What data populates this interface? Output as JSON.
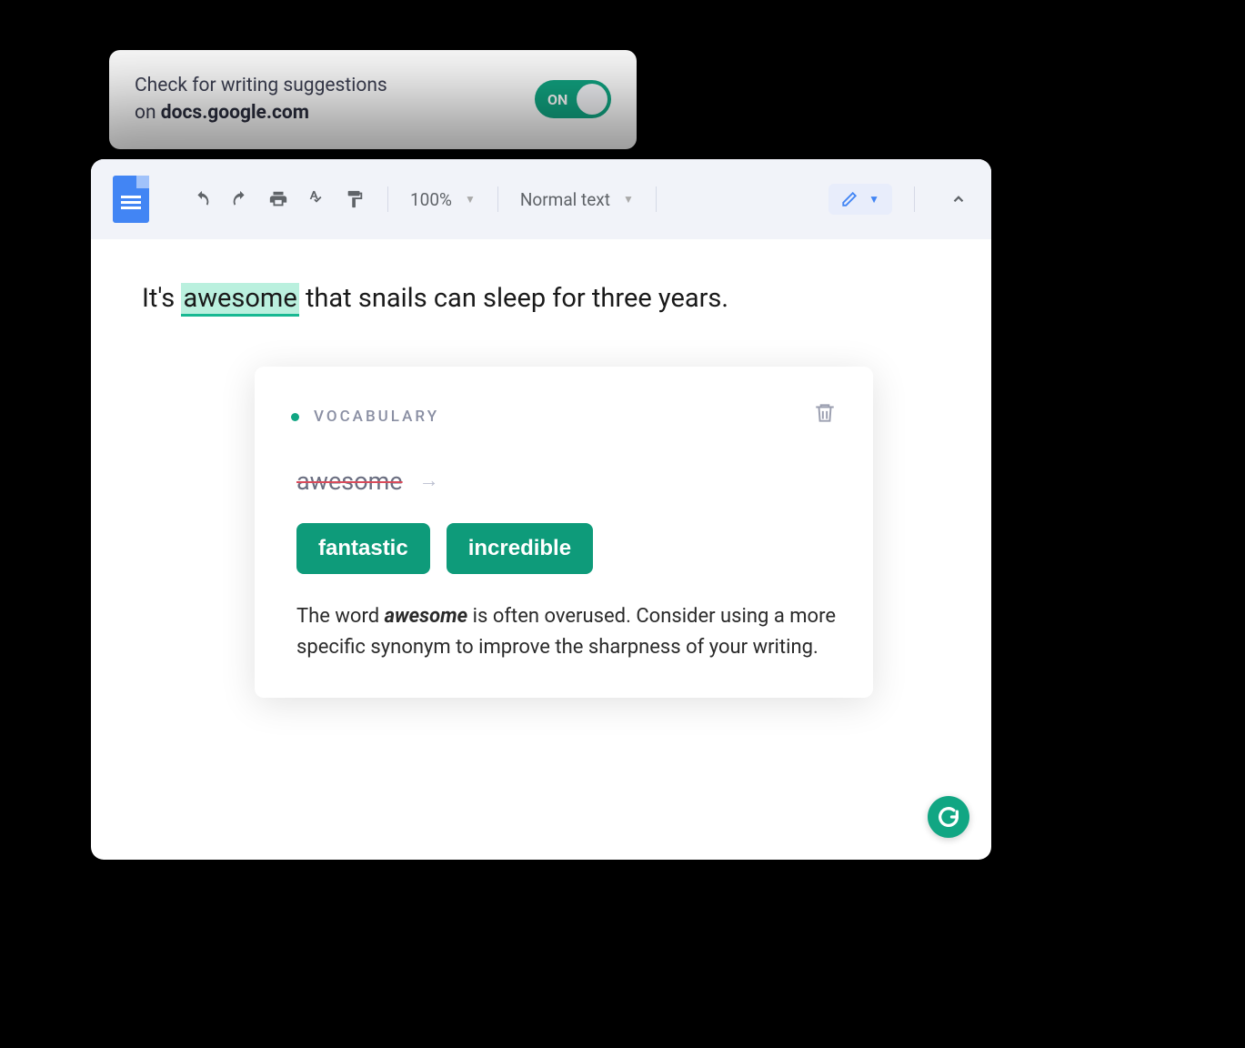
{
  "settings": {
    "line1": "Check for writing suggestions",
    "line2_prefix": "on ",
    "line2_domain": "docs.google.com",
    "toggle_label": "ON",
    "toggle_state": true
  },
  "toolbar": {
    "zoom": "100%",
    "style": "Normal text"
  },
  "document": {
    "text_before": "It's ",
    "highlighted": "awesome",
    "text_after": " that snails can sleep for three years."
  },
  "suggestion": {
    "category": "VOCABULARY",
    "original": "awesome",
    "options": [
      "fantastic",
      "incredible"
    ],
    "description_before": "The word ",
    "description_emph": "awesome",
    "description_after": " is often overused. Consider using a more specific synonym to improve the sharpness of your writing."
  }
}
